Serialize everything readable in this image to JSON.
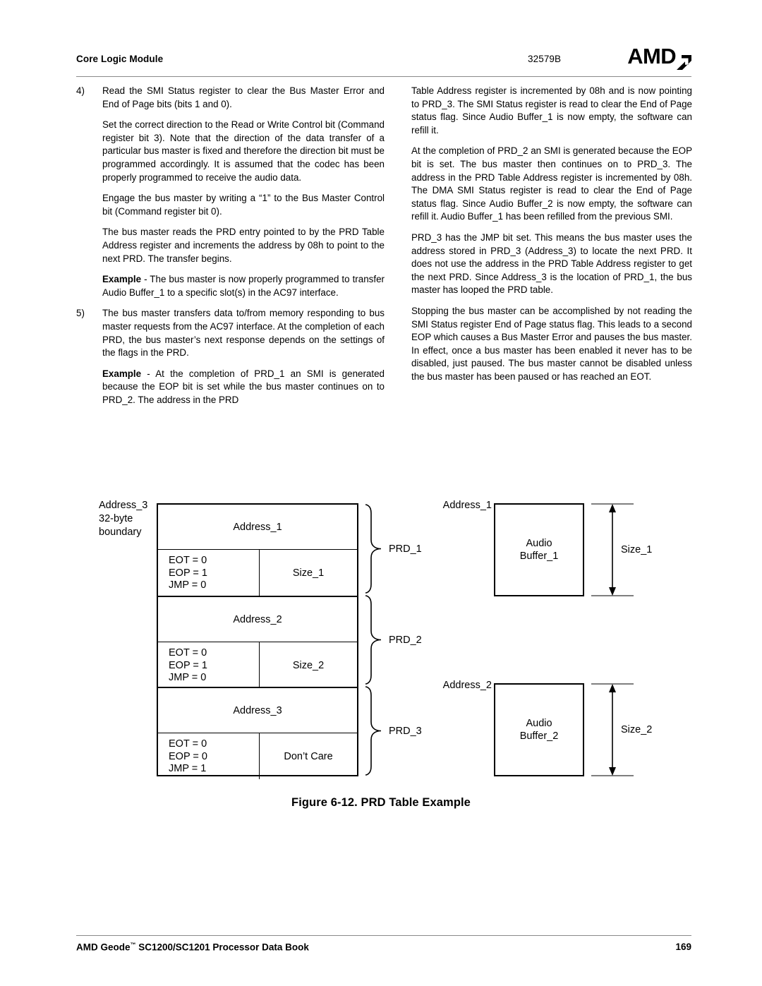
{
  "header": {
    "title": "Core Logic Module",
    "doc_number": "32579B",
    "logo_text": "AMD"
  },
  "left_column": {
    "item4_num": "4)",
    "item4_text": "Read the SMI Status register to clear the Bus Master Error and End of Page bits (bits 1 and 0).",
    "para_set_direction": "Set the correct direction to the Read or Write Control bit (Command register bit 3). Note that the direction of the data transfer of a particular bus master is fixed and therefore the direction bit must be programmed accordingly. It is assumed that the codec has been properly programmed to receive the audio data.",
    "para_engage": "Engage the bus master by writing a “1” to the Bus Master Control bit (Command register bit 0).",
    "para_reads_prd": "The bus master reads the PRD entry pointed to by the PRD Table Address register and increments the address by 08h to point to the next PRD. The transfer begins.",
    "example1_label": "Example",
    "example1_text": " - The bus master is now properly programmed to transfer Audio Buffer_1 to a specific slot(s) in the AC97 interface.",
    "item5_num": "5)",
    "item5_text": "The bus master transfers data to/from memory responding to bus master requests from the AC97 interface. At the completion of each PRD, the bus master’s next response depends on the settings of the flags in the PRD.",
    "example2_label": "Example",
    "example2_text": " - At the completion of PRD_1 an SMI is generated because the EOP bit is set while the bus master continues on to PRD_2. The address in the PRD"
  },
  "right_column": {
    "para_continued": "Table Address register is incremented by 08h and is now pointing to PRD_3. The SMI Status register is read to clear the End of Page status flag. Since Audio Buffer_1 is now empty, the software can refill it.",
    "para_prd2": "At the completion of PRD_2 an SMI is generated because the EOP bit is set. The bus master then continues on to PRD_3. The address in the PRD Table Address register is incremented by 08h. The DMA SMI Status register is read to clear the End of Page status flag. Since Audio Buffer_2 is now empty, the software can refill it. Audio Buffer_1 has been refilled from the previous SMI.",
    "para_prd3": "PRD_3 has the JMP bit set. This means the bus master uses the address stored in PRD_3 (Address_3) to locate the next PRD. It does not use the address in the PRD Table Address register to get the next PRD. Since Address_3 is the location of PRD_1, the bus master has looped the PRD table.",
    "para_stopping": "Stopping the bus master can be accomplished by not reading the SMI Status register End of Page status flag. This leads to a second EOP which causes a Bus Master Error and pauses the bus master. In effect, once a bus master has been enabled it never has to be disabled, just paused. The bus master cannot be disabled unless the bus master has been paused or has reached an EOT."
  },
  "figure": {
    "caption": "Figure 6-12.  PRD Table Example",
    "boundary_label_line1": "Address_3",
    "boundary_label_line2": "32-byte",
    "boundary_label_line3": "boundary",
    "entries": [
      {
        "address": "Address_1",
        "eot": "EOT = 0",
        "eop": "EOP = 1",
        "jmp": "JMP = 0",
        "size": "Size_1",
        "prd_label": "PRD_1"
      },
      {
        "address": "Address_2",
        "eot": "EOT = 0",
        "eop": "EOP = 1",
        "jmp": "JMP = 0",
        "size": "Size_2",
        "prd_label": "PRD_2"
      },
      {
        "address": "Address_3",
        "eot": "EOT = 0",
        "eop": "EOP = 0",
        "jmp": "JMP = 1",
        "size": "Don’t Care",
        "prd_label": "PRD_3"
      }
    ],
    "buffers": [
      {
        "addr_label": "Address_1",
        "name_line1": "Audio",
        "name_line2": "Buffer_1",
        "size_label": "Size_1"
      },
      {
        "addr_label": "Address_2",
        "name_line1": "Audio",
        "name_line2": "Buffer_2",
        "size_label": "Size_2"
      }
    ]
  },
  "footer": {
    "text_before_tm": "AMD Geode",
    "tm": "™",
    "text_after_tm": " SC1200/SC1201 Processor Data Book",
    "page_number": "169"
  }
}
